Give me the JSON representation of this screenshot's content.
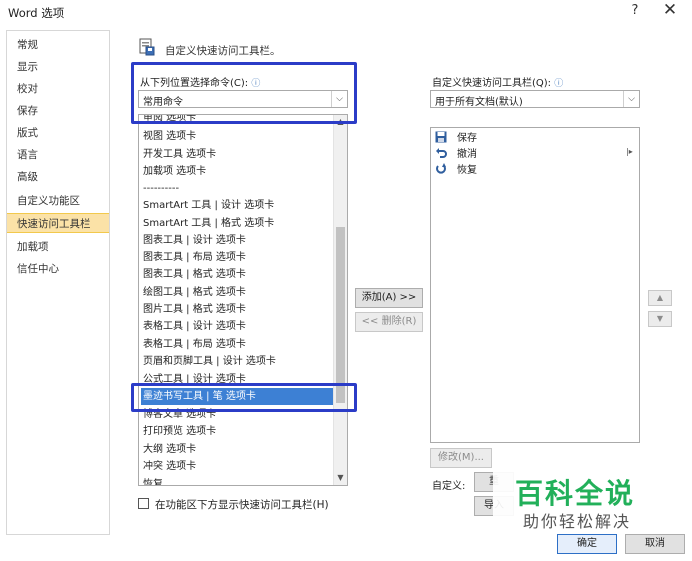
{
  "window": {
    "title": "Word 选项",
    "help": "?",
    "close": "✕"
  },
  "nav": {
    "items": [
      {
        "label": "常规"
      },
      {
        "label": "显示"
      },
      {
        "label": "校对"
      },
      {
        "label": "保存"
      },
      {
        "label": "版式"
      },
      {
        "label": "语言"
      },
      {
        "label": "高级"
      },
      {
        "label": "自定义功能区"
      },
      {
        "label": "快速访问工具栏"
      },
      {
        "label": "加载项"
      },
      {
        "label": "信任中心"
      }
    ],
    "selected": "快速访问工具栏"
  },
  "main": {
    "heading": "自定义快速访问工具栏。",
    "choose_label": "从下列位置选择命令(C):",
    "choose_value": "常用命令",
    "customize_label": "自定义快速访问工具栏(Q):",
    "customize_value": "用于所有文档(默认)",
    "commands": [
      "审阅 选项卡",
      "视图 选项卡",
      "开发工具 选项卡",
      "加载项 选项卡",
      "----------",
      "SmartArt 工具 | 设计 选项卡",
      "SmartArt 工具 | 格式 选项卡",
      "图表工具 | 设计 选项卡",
      "图表工具 | 布局 选项卡",
      "图表工具 | 格式 选项卡",
      "绘图工具 | 格式 选项卡",
      "图片工具 | 格式 选项卡",
      "表格工具 | 设计 选项卡",
      "表格工具 | 布局 选项卡",
      "页眉和页脚工具 | 设计 选项卡",
      "公式工具 | 设计 选项卡",
      "墨迹书写工具 | 笔 选项卡",
      "博客文章 选项卡",
      "打印预览 选项卡",
      "大纲 选项卡",
      "冲突 选项卡",
      "恢复"
    ],
    "selected_command": "墨迹书写工具 | 笔 选项卡",
    "add_button": "添加(A) >>",
    "remove_button": "<< 删除(R)",
    "toolbar_items": [
      {
        "label": "保存",
        "icon": "save-icon"
      },
      {
        "label": "撤消",
        "icon": "undo-icon"
      },
      {
        "label": "恢复",
        "icon": "redo-icon"
      }
    ],
    "modify_button": "修改(M)...",
    "customizations_label": "自定义:",
    "reset_button": "重",
    "import_button": "导入",
    "show_below_ribbon": "在功能区下方显示快速访问工具栏(H)",
    "show_below_checked": false
  },
  "footer": {
    "ok": "确定",
    "cancel": "取消"
  },
  "watermark": {
    "title": "百科全说",
    "subtitle": "助你轻松解决"
  },
  "colors": {
    "selection": "#3d80d4",
    "nav_selected": "#fbe2a7",
    "highlight_box": "#2b3cc7",
    "watermark": "#22b05a"
  }
}
